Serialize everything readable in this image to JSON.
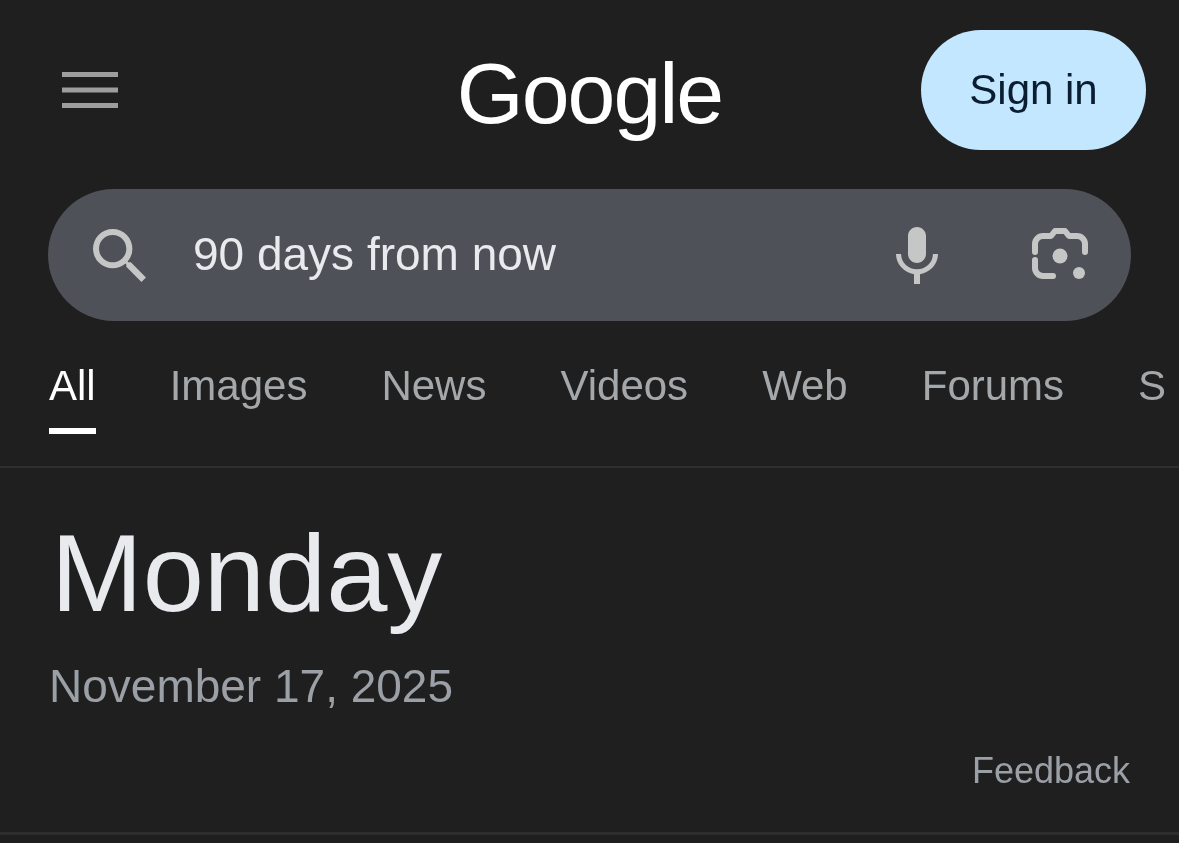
{
  "header": {
    "logo": "Google",
    "sign_in_button": "Sign in"
  },
  "search": {
    "value": "90 days from now"
  },
  "tabs": [
    {
      "label": "All",
      "selected": true
    },
    {
      "label": "Images",
      "selected": false
    },
    {
      "label": "News",
      "selected": false
    },
    {
      "label": "Videos",
      "selected": false
    },
    {
      "label": "Web",
      "selected": false
    },
    {
      "label": "Forums",
      "selected": false
    },
    {
      "label": "S",
      "selected": false
    }
  ],
  "result": {
    "day": "Monday",
    "date": "November 17, 2025",
    "feedback_link": "Feedback"
  }
}
